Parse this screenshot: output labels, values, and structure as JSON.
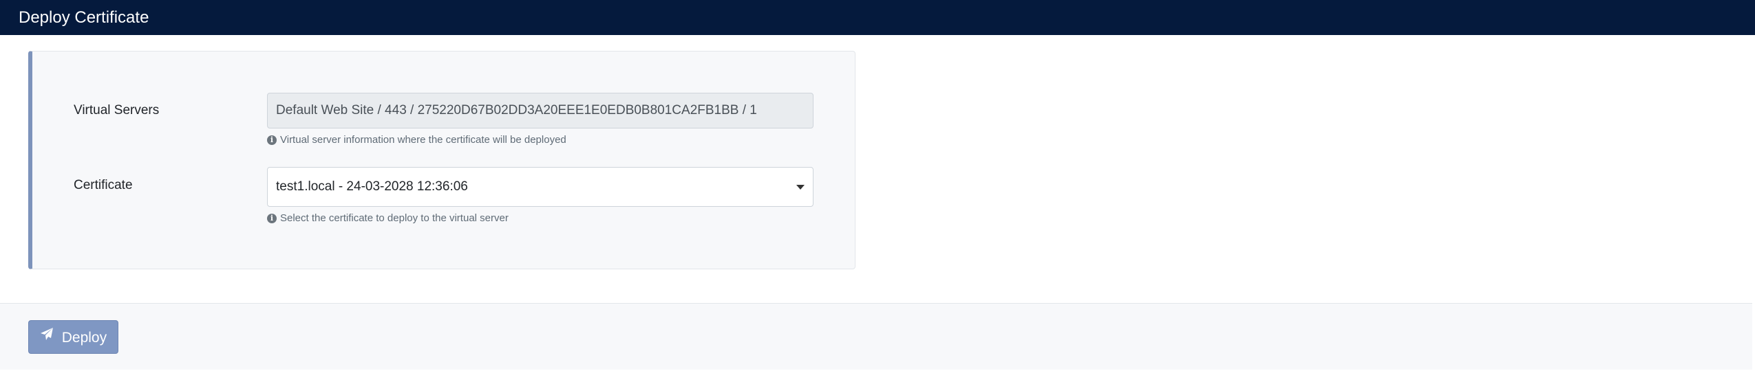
{
  "header": {
    "title": "Deploy Certificate"
  },
  "form": {
    "virtual_servers": {
      "label": "Virtual Servers",
      "value": "Default Web Site / 443 / 275220D67B02DD3A20EEE1E0EDB0B801CA2FB1BB / 1",
      "help": "Virtual server information where the certificate will be deployed",
      "help_icon": "info-icon"
    },
    "certificate": {
      "label": "Certificate",
      "selected": "test1.local - 24-03-2028 12:36:06",
      "help": "Select the certificate to deploy to the virtual server",
      "help_icon": "info-icon",
      "arrow_icon": "caret-down-icon"
    }
  },
  "footer": {
    "deploy_label": "Deploy",
    "deploy_icon": "paper-plane-icon"
  },
  "colors": {
    "header_bg": "#051a3d",
    "card_accent": "#7d93bb",
    "button_bg": "#7f97c3"
  }
}
